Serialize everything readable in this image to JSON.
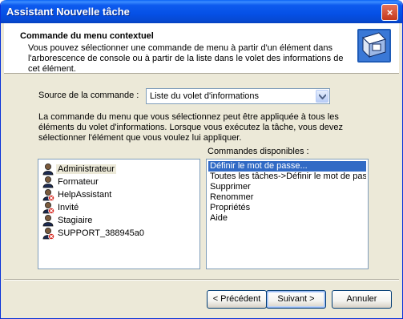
{
  "window": {
    "title": "Assistant Nouvelle tâche"
  },
  "header": {
    "title": "Commande du menu contextuel",
    "description": "Vous pouvez sélectionner une commande de menu à partir d'un élément dans l'arborescence de console ou à partir de la liste dans le volet des informations de cet élément."
  },
  "source": {
    "label": "Source de la commande :",
    "selected": "Liste du volet d'informations"
  },
  "paragraph": "La commande du menu que vous sélectionnez peut être appliquée à tous les éléments du volet d'informations. Lorsque vous exécutez la tâche, vous devez sélectionner l'élément que vous voulez lui appliquer.",
  "users": [
    {
      "name": "Administrateur",
      "disabled": false,
      "selected": true
    },
    {
      "name": "Formateur",
      "disabled": false,
      "selected": false
    },
    {
      "name": "HelpAssistant",
      "disabled": true,
      "selected": false
    },
    {
      "name": "Invité",
      "disabled": true,
      "selected": false
    },
    {
      "name": "Stagiaire",
      "disabled": false,
      "selected": false
    },
    {
      "name": "SUPPORT_388945a0",
      "disabled": true,
      "selected": false
    }
  ],
  "commands": {
    "label": "Commandes disponibles :",
    "items": [
      {
        "label": "Définir le mot de passe...",
        "selected": true
      },
      {
        "label": "Toutes les tâches->Définir le mot de passe...",
        "selected": false
      },
      {
        "label": "Supprimer",
        "selected": false
      },
      {
        "label": "Renommer",
        "selected": false
      },
      {
        "label": "Propriétés",
        "selected": false
      },
      {
        "label": "Aide",
        "selected": false
      }
    ]
  },
  "buttons": {
    "back": "< Précédent",
    "next": "Suivant >",
    "cancel": "Annuler",
    "close": "×"
  },
  "colors": {
    "titlebar": "#0550E6",
    "selection": "#316AC5",
    "face": "#ECE9D8"
  }
}
